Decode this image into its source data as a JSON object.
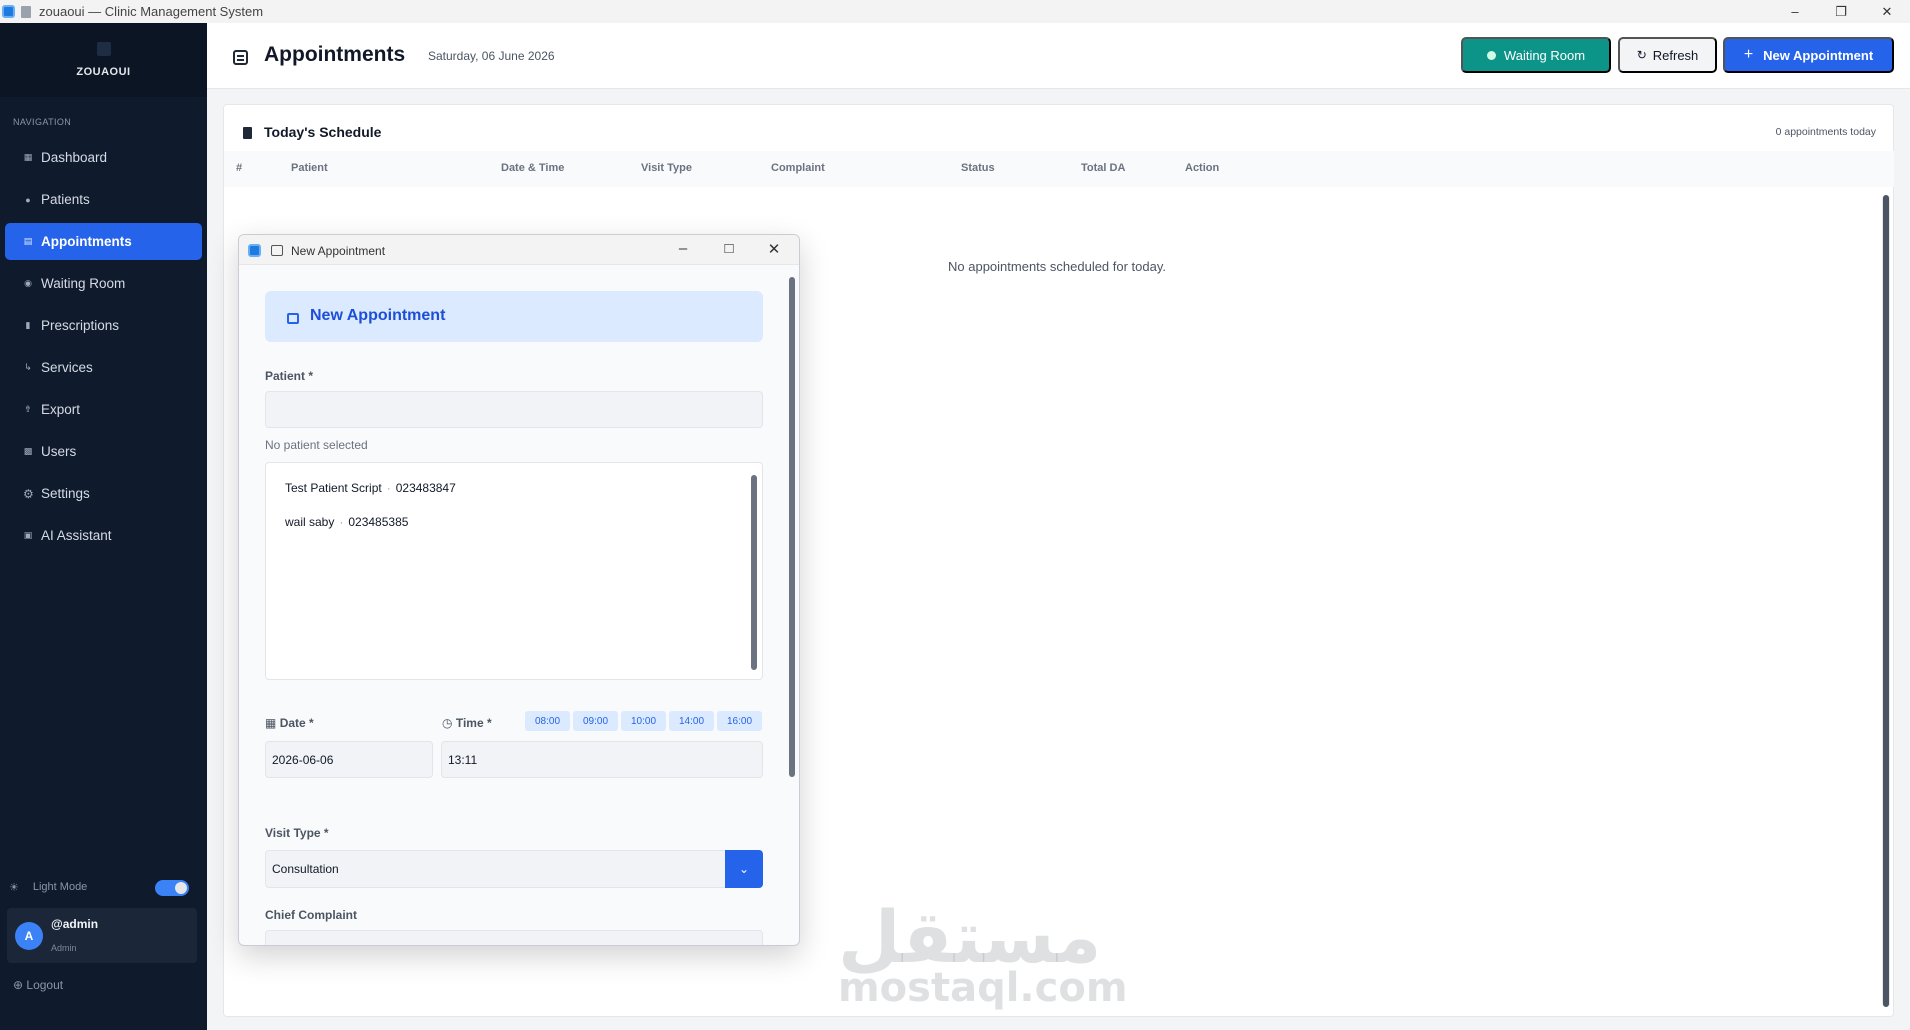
{
  "window": {
    "app": "zouaoui",
    "separator": "—",
    "title": "Clinic Management System"
  },
  "sidebar": {
    "brand": "ZOUAOUI",
    "nav_label": "NAVIGATION",
    "items": [
      {
        "label": "Dashboard",
        "icon": "dashboard-icon"
      },
      {
        "label": "Patients",
        "icon": "patient-icon"
      },
      {
        "label": "Appointments",
        "icon": "calendar-icon",
        "active": true
      },
      {
        "label": "Waiting Room",
        "icon": "waiting-icon"
      },
      {
        "label": "Prescriptions",
        "icon": "prescription-icon"
      },
      {
        "label": "Services",
        "icon": "services-icon"
      },
      {
        "label": "Export",
        "icon": "export-icon"
      },
      {
        "label": "Users",
        "icon": "users-icon"
      },
      {
        "label": "Settings",
        "icon": "gear-icon"
      },
      {
        "label": "AI Assistant",
        "icon": "ai-icon"
      }
    ],
    "light_mode_label": "Light Mode",
    "user": {
      "initial": "A",
      "name": "@admin",
      "role": "Admin"
    },
    "logout_label": "Logout"
  },
  "header": {
    "title": "Appointments",
    "date": "Saturday, 06 June 2026",
    "waiting_room_label": "Waiting Room",
    "refresh_label": "Refresh",
    "new_appointment_label": "New Appointment"
  },
  "schedule": {
    "title": "Today's Schedule",
    "count": "0 appointments today",
    "columns": [
      "#",
      "Patient",
      "Date & Time",
      "Visit Type",
      "Complaint",
      "Status",
      "Total DA",
      "Action"
    ],
    "empty_message": "No appointments scheduled for today."
  },
  "dialog": {
    "window_title": "New Appointment",
    "banner_title": "New Appointment",
    "patient_label": "Patient *",
    "patient_value": "",
    "no_patient": "No patient selected",
    "patients": [
      {
        "name": "Test Patient Script",
        "phone": "023483847"
      },
      {
        "name": "wail saby",
        "phone": "023485385"
      }
    ],
    "date_label": "Date *",
    "time_label": "Time *",
    "time_presets": [
      "08:00",
      "09:00",
      "10:00",
      "14:00",
      "16:00"
    ],
    "date_value": "2026-06-06",
    "time_value": "13:11",
    "visit_type_label": "Visit Type *",
    "visit_type_value": "Consultation",
    "complaint_label": "Chief Complaint",
    "complaint_value": ""
  },
  "watermark": {
    "arabic": "مستقل",
    "latin": "mostaql.com"
  },
  "colors": {
    "primary": "#2563eb",
    "teal": "#0d9488",
    "sidebar": "#0f1b2d"
  }
}
